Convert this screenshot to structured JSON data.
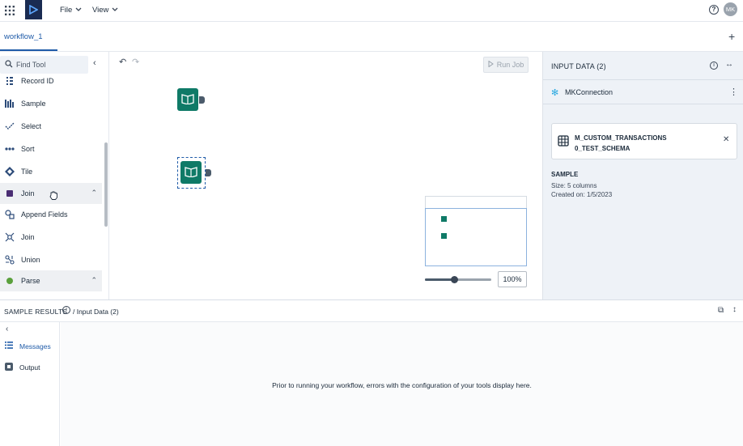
{
  "topbar": {
    "menus": [
      {
        "label": "File"
      },
      {
        "label": "View"
      }
    ],
    "avatar_initials": "MK"
  },
  "tabs": {
    "active_label": "workflow_1"
  },
  "tool_palette": {
    "search_placeholder": "Find Tool",
    "items": [
      {
        "label": "Record ID",
        "icon": "record-id-icon"
      },
      {
        "label": "Sample",
        "icon": "sample-icon"
      },
      {
        "label": "Select",
        "icon": "select-icon"
      },
      {
        "label": "Sort",
        "icon": "sort-icon"
      },
      {
        "label": "Tile",
        "icon": "tile-icon"
      },
      {
        "label": "Join",
        "icon": "join-category-icon",
        "category": true,
        "color": "#4a2d73"
      },
      {
        "label": "Append Fields",
        "icon": "append-fields-icon"
      },
      {
        "label": "Join",
        "icon": "join-icon"
      },
      {
        "label": "Union",
        "icon": "union-icon"
      },
      {
        "label": "Parse",
        "icon": "parse-category-icon",
        "category": true,
        "color": "#5aa03c"
      }
    ]
  },
  "canvas": {
    "run_job_label": "Run Job",
    "zoom_label": "100%",
    "zoom_level": 0.45
  },
  "input_panel": {
    "title": "INPUT DATA (2)",
    "connection_name": "MKConnection",
    "table_name_line1": "M_CUSTOM_TRANSACTIONS",
    "table_name_line2": "0_TEST_SCHEMA",
    "sample_heading": "SAMPLE",
    "sample_size": "Size: 5 columns",
    "sample_created": "Created on: 1/5/2023"
  },
  "results": {
    "title": "SAMPLE RESULTS",
    "breadcrumb": "/ Input Data (2)",
    "side_items": [
      {
        "label": "Messages",
        "icon": "list-icon",
        "active": true
      },
      {
        "label": "Output",
        "icon": "output-icon",
        "active": false
      }
    ],
    "empty_message": "Prior to running your workflow, errors with the configuration of your tools display here."
  },
  "colors": {
    "accent": "#1f5ba8",
    "node_green": "#0f7a67",
    "brand_navy": "#1a2b52"
  }
}
